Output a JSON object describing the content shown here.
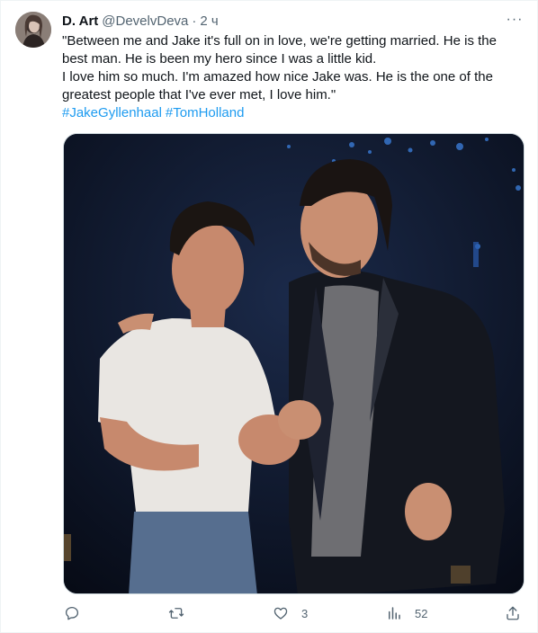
{
  "tweet": {
    "author_name": "D. Art",
    "handle": "@DevelvDeva",
    "separator": "·",
    "time": "2 ч",
    "more_glyph": "···",
    "lines": [
      "\"Between me and Jake it's full on in love, we're getting married. He is the",
      "best man. He is been my hero since I was a little kid.",
      "I love him so much. I'm amazed how nice Jake was. He is the one of the",
      "greatest people that I've ever met, I love him.\""
    ],
    "hashtags": [
      "#JakeGyllenhaal",
      "#TomHolland"
    ]
  },
  "actions": {
    "reply": {
      "icon": "reply-icon",
      "count": ""
    },
    "retweet": {
      "icon": "retweet-icon",
      "count": ""
    },
    "like": {
      "icon": "heart-icon",
      "count": "3"
    },
    "views": {
      "icon": "views-icon",
      "count": "52"
    },
    "share": {
      "icon": "share-icon"
    }
  },
  "colors": {
    "link": "#1d9bf0",
    "muted": "#536471",
    "text": "#0f1419"
  }
}
